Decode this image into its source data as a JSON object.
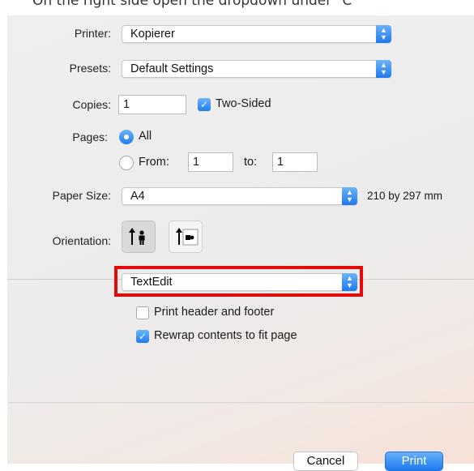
{
  "caption": "On the right side open the dropdown under \"C",
  "printer": {
    "label": "Printer:",
    "value": "Kopierer"
  },
  "presets": {
    "label": "Presets:",
    "value": "Default Settings"
  },
  "copies": {
    "label": "Copies:",
    "value": "1",
    "two_sided_label": "Two-Sided",
    "two_sided_checked": true
  },
  "pages": {
    "label": "Pages:",
    "all_label": "All",
    "from_label": "From:",
    "from_value": "1",
    "to_label": "to:",
    "to_value": "1",
    "selected": "All"
  },
  "paper_size": {
    "label": "Paper Size:",
    "value": "A4",
    "dimensions": "210 by 297 mm"
  },
  "orientation": {
    "label": "Orientation:",
    "selected": "portrait"
  },
  "app_section": {
    "value": "TextEdit"
  },
  "options": [
    {
      "label": "Print header and footer",
      "checked": false
    },
    {
      "label": "Rewrap contents to fit page",
      "checked": true
    }
  ],
  "buttons": {
    "cancel": "Cancel",
    "print": "Print"
  },
  "colors": {
    "accent": "#1e78ef",
    "highlight": "#e30a0a"
  }
}
